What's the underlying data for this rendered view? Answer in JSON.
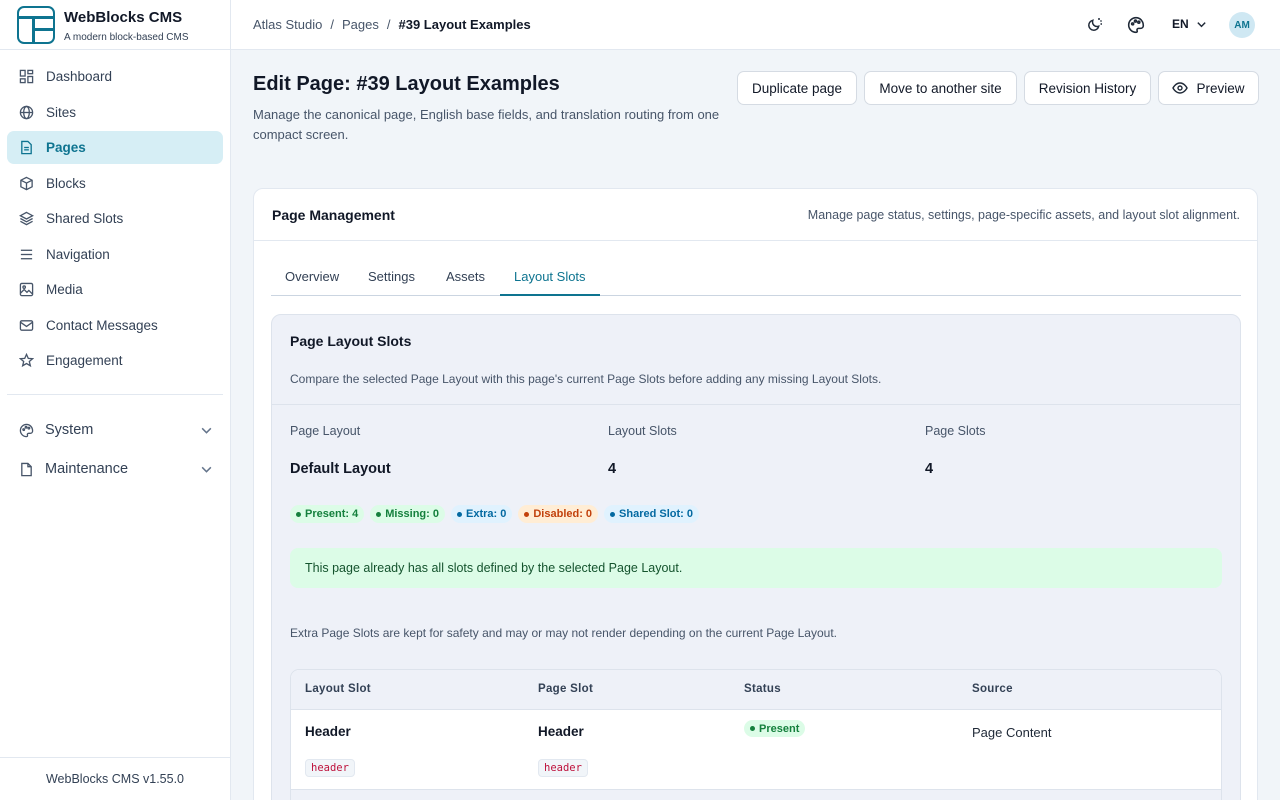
{
  "brand": {
    "title": "WebBlocks CMS",
    "subtitle": "A modern block-based CMS",
    "version": "WebBlocks CMS v1.55.0"
  },
  "sidebar": {
    "items": [
      {
        "label": "Dashboard",
        "icon": "dashboard-icon"
      },
      {
        "label": "Sites",
        "icon": "globe-icon"
      },
      {
        "label": "Pages",
        "icon": "document-icon",
        "active": true
      },
      {
        "label": "Blocks",
        "icon": "cube-icon"
      },
      {
        "label": "Shared Slots",
        "icon": "layers-icon"
      },
      {
        "label": "Navigation",
        "icon": "menu-icon"
      },
      {
        "label": "Media",
        "icon": "image-icon"
      },
      {
        "label": "Contact Messages",
        "icon": "mail-icon"
      },
      {
        "label": "Engagement",
        "icon": "star-icon"
      }
    ],
    "groups": [
      {
        "label": "System",
        "icon": "palette-icon"
      },
      {
        "label": "Maintenance",
        "icon": "file-icon"
      }
    ]
  },
  "topbar": {
    "breadcrumbs": [
      "Atlas Studio",
      "Pages",
      "#39 Layout Examples"
    ],
    "separator": "/",
    "language": "EN",
    "avatar_initials": "AM"
  },
  "page": {
    "title": "Edit Page: #39 Layout Examples",
    "description": "Manage the canonical page, English base fields, and translation routing from one compact screen.",
    "actions": {
      "duplicate": "Duplicate page",
      "move": "Move to another site",
      "history": "Revision History",
      "preview": "Preview"
    }
  },
  "card": {
    "title": "Page Management",
    "description": "Manage page status, settings, page-specific assets, and layout slot alignment.",
    "tabs": [
      "Overview",
      "Settings",
      "Assets",
      "Layout Slots"
    ],
    "active_tab": "Layout Slots"
  },
  "panel": {
    "title": "Page Layout Slots",
    "description": "Compare the selected Page Layout with this page's current Page Slots before adding any missing Layout Slots.",
    "stats": [
      {
        "label": "Page Layout",
        "value": "Default Layout"
      },
      {
        "label": "Layout Slots",
        "value": "4"
      },
      {
        "label": "Page Slots",
        "value": "4"
      }
    ],
    "badges": [
      {
        "label": "Present: 4",
        "bg": "#dcfce7",
        "fg": "#15803d"
      },
      {
        "label": "Missing: 0",
        "bg": "#dcfce7",
        "fg": "#15803d"
      },
      {
        "label": "Extra: 0",
        "bg": "#e0f2fe",
        "fg": "#0369a1"
      },
      {
        "label": "Disabled: 0",
        "bg": "#ffedd5",
        "fg": "#c2410c"
      },
      {
        "label": "Shared Slot: 0",
        "bg": "#e0f2fe",
        "fg": "#0369a1"
      }
    ],
    "alert": "This page already has all slots defined by the selected Page Layout.",
    "note": "Extra Page Slots are kept for safety and may or may not render depending on the current Page Layout."
  },
  "table": {
    "columns": [
      "Layout Slot",
      "Page Slot",
      "Status",
      "Source"
    ],
    "rows": [
      {
        "layout_slot": "Header",
        "layout_code": "header",
        "page_slot": "Header",
        "page_code": "header",
        "status": "Present",
        "source": "Page Content"
      }
    ]
  },
  "colors": {
    "accent": "#0e7490",
    "active_bg": "#d6eef5",
    "success_bg": "#dcfce7"
  }
}
